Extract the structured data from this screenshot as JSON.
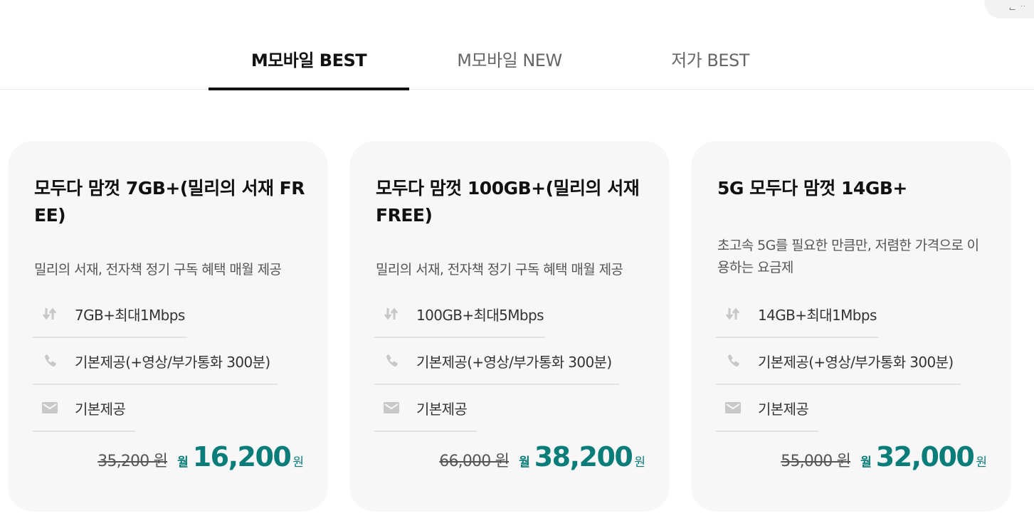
{
  "tabs": [
    {
      "label": "M모바일 BEST",
      "active": true
    },
    {
      "label": "M모바일 NEW",
      "active": false
    },
    {
      "label": "저가 BEST",
      "active": false
    }
  ],
  "icons": {
    "data": "data-updown-icon",
    "call": "phone-icon",
    "sms": "mail-icon"
  },
  "colors": {
    "accent": "#0a7d7a",
    "card_bg": "#f7f7f7",
    "active_tab": "#111111"
  },
  "plans": [
    {
      "title": "모두다 맘껏 7GB+(밀리의 서재 FREE)",
      "description": "밀리의 서재, 전자책 정기 구독 혜택 매월 제공",
      "data": "7GB+최대1Mbps",
      "call": "기본제공(+영상/부가통화 300분)",
      "sms": "기본제공",
      "original_price": "35,200 원",
      "month_label": "월",
      "price": "16,200",
      "price_unit": "원"
    },
    {
      "title": "모두다 맘껏 100GB+(밀리의 서재 FREE)",
      "description": "밀리의 서재, 전자책 정기 구독 혜택 매월 제공",
      "data": "100GB+최대5Mbps",
      "call": "기본제공(+영상/부가통화 300분)",
      "sms": "기본제공",
      "original_price": "66,000 원",
      "month_label": "월",
      "price": "38,200",
      "price_unit": "원"
    },
    {
      "title": "5G 모두다 맘껏 14GB+",
      "description": "초고속 5G를 필요한 만큼만, 저렴한 가격으로 이용하는 요금제",
      "data": "14GB+최대1Mbps",
      "call": "기본제공(+영상/부가통화 300분)",
      "sms": "기본제공",
      "original_price": "55,000 원",
      "month_label": "월",
      "price": "32,000",
      "price_unit": "원"
    }
  ]
}
